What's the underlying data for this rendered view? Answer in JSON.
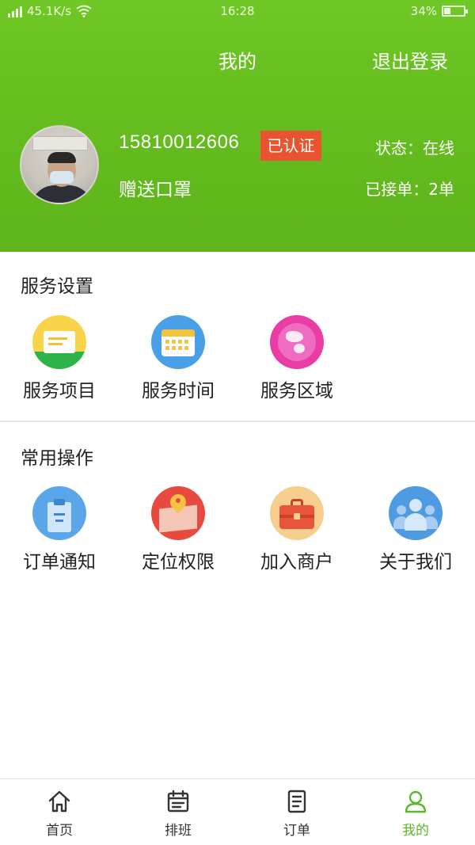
{
  "status_bar": {
    "network": "45.1K/s",
    "time": "16:28",
    "battery": "34%",
    "battery_level": 0.34
  },
  "header": {
    "title": "我的",
    "logout": "退出登录"
  },
  "profile": {
    "phone": "15810012606",
    "verified_badge": "已认证",
    "subtitle": "赠送口罩",
    "status": "状态：在线",
    "orders": "已接单：2单"
  },
  "service_settings": {
    "title": "服务设置",
    "items": [
      {
        "label": "服务项目",
        "icon": "service-project-icon"
      },
      {
        "label": "服务时间",
        "icon": "calendar-icon"
      },
      {
        "label": "服务区域",
        "icon": "globe-icon"
      }
    ]
  },
  "common_actions": {
    "title": "常用操作",
    "items": [
      {
        "label": "订单通知",
        "icon": "clipboard-icon"
      },
      {
        "label": "定位权限",
        "icon": "location-pin-icon"
      },
      {
        "label": "加入商户",
        "icon": "briefcase-icon"
      },
      {
        "label": "关于我们",
        "icon": "people-icon"
      }
    ]
  },
  "tabbar": {
    "items": [
      {
        "label": "首页",
        "icon": "home-icon"
      },
      {
        "label": "排班",
        "icon": "schedule-icon"
      },
      {
        "label": "订单",
        "icon": "document-icon"
      },
      {
        "label": "我的",
        "icon": "user-icon"
      }
    ],
    "active_index": 3,
    "active_color": "#5cb82a"
  },
  "colors": {
    "header_green": "#66be1f",
    "badge_red": "#e8542f"
  }
}
